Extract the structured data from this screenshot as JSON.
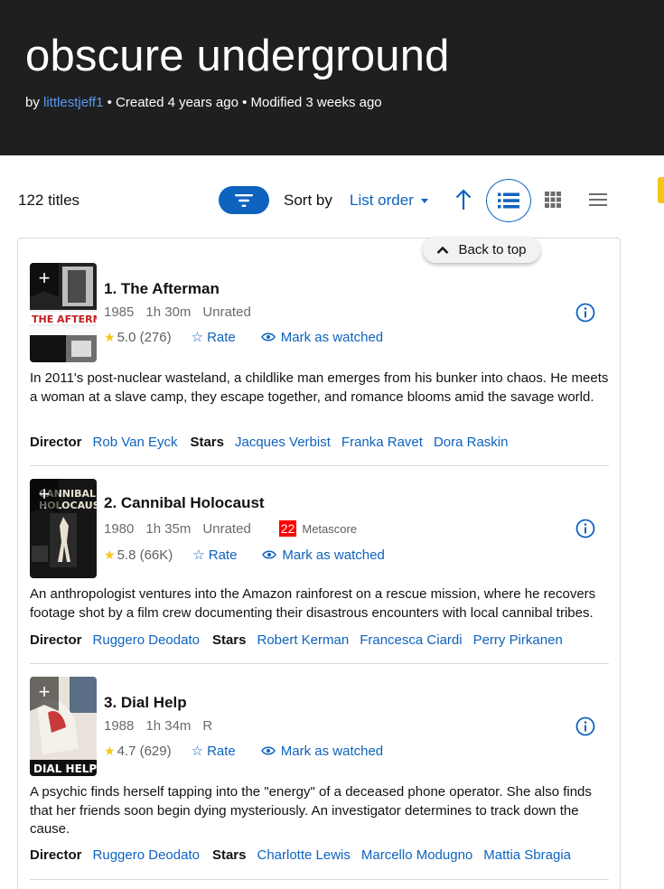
{
  "header": {
    "title": "obscure underground",
    "by_prefix": "by",
    "author": "littlestjeff1",
    "created": "• Created 4 years ago",
    "modified": "• Modified 3 weeks ago"
  },
  "toolbar": {
    "count": "122 titles",
    "sort_label": "Sort by",
    "sort_value": "List order",
    "icons": {
      "filter": "filter-icon",
      "sort_direction": "arrow-up-icon",
      "detailed_view": "detailed-list-icon",
      "grid_view": "grid-icon",
      "compact_view": "compact-list-icon"
    }
  },
  "back_to_top": "Back to top",
  "colors": {
    "accent": "#0e63be",
    "header_bg": "#1f1f1f",
    "star": "#f5c518",
    "metascore_bg": "#ff0000"
  },
  "common": {
    "rate": "Rate",
    "mark_watched": "Mark as watched",
    "director_label": "Director",
    "stars_label": "Stars",
    "metascore_label": "Metascore"
  },
  "items": [
    {
      "title": "1. The Afterman",
      "year": "1985",
      "runtime": "1h 30m",
      "certificate": "Unrated",
      "rating": "5.0",
      "votes": "(276)",
      "plot": "In 2011's post-nuclear wasteland, a childlike man emerges from his bunker into chaos. He meets a woman at a slave camp, they escape together, and romance blooms amid the savage world.",
      "director": "Rob Van Eyck",
      "stars": [
        "Jacques Verbist",
        "Franka Ravet",
        "Dora Raskin"
      ]
    },
    {
      "title": "2. Cannibal Holocaust",
      "year": "1980",
      "runtime": "1h 35m",
      "certificate": "Unrated",
      "metascore": "22",
      "rating": "5.8",
      "votes": "(66K)",
      "plot": "An anthropologist ventures into the Amazon rainforest on a rescue mission, where he recovers footage shot by a film crew documenting their disastrous encounters with local cannibal tribes.",
      "director": "Ruggero Deodato",
      "stars": [
        "Robert Kerman",
        "Francesca Ciardi",
        "Perry Pirkanen"
      ]
    },
    {
      "title": "3. Dial Help",
      "year": "1988",
      "runtime": "1h 34m",
      "certificate": "R",
      "rating": "4.7",
      "votes": "(629)",
      "plot": "A psychic finds herself tapping into the \"energy\" of a deceased phone operator. She also finds that her friends soon begin dying mysteriously. An investigator determines to track down the cause.",
      "director": "Ruggero Deodato",
      "stars": [
        "Charlotte Lewis",
        "Marcello Modugno",
        "Mattia Sbragia"
      ]
    }
  ]
}
